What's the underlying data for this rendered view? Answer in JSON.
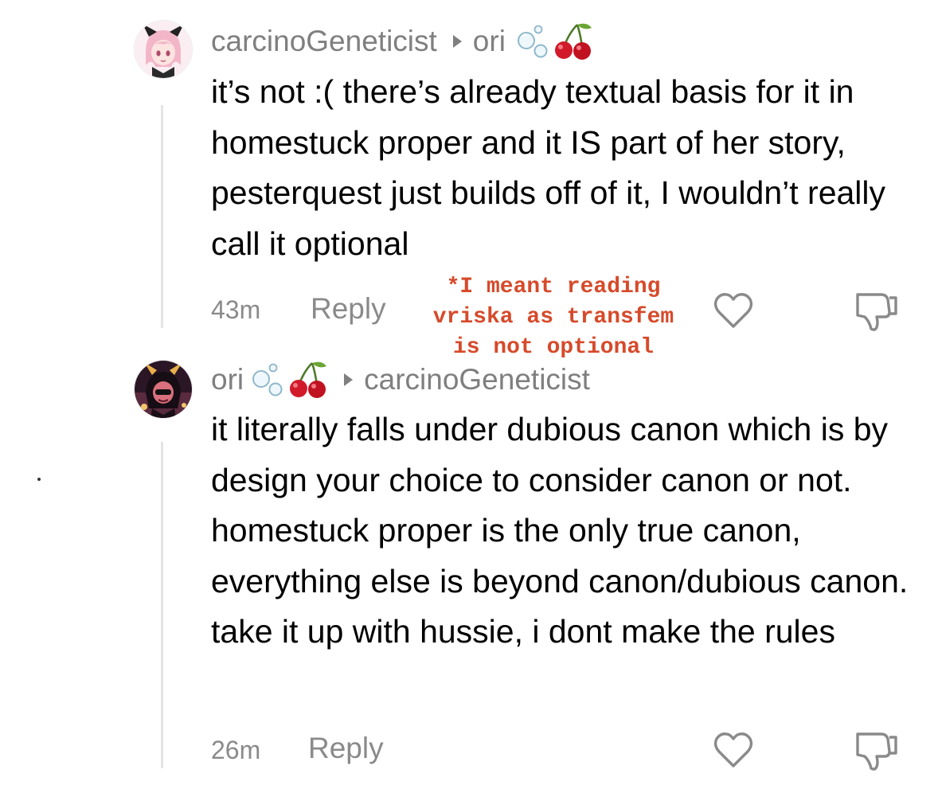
{
  "comments": [
    {
      "author": "carcinoGeneticist",
      "reply_to": "ori",
      "text": "it’s not :( there’s already textual basis for it in homestuck proper and it IS part of her story, pesterquest just builds off of it, I wouldn’t really call it optional",
      "time": "43m",
      "reply_label": "Reply"
    },
    {
      "author": "ori",
      "reply_to": "carcinoGeneticist",
      "text": "it literally falls under dubious canon which is by design your choice to consider canon or not. homestuck proper is the only true canon, everything else is beyond canon/dubious canon. take it up with hussie, i dont make the rules",
      "time": "26m",
      "reply_label": "Reply"
    }
  ],
  "annotation": {
    "lines": [
      "*I meant reading",
      "vriska as transfem",
      "is not optional"
    ],
    "color": "#d64a2a"
  },
  "icons": {
    "like": "heart-outline-icon",
    "dislike": "thumbs-down-icon",
    "name_emojis": [
      "bubbles-icon",
      "cherries-icon"
    ]
  }
}
